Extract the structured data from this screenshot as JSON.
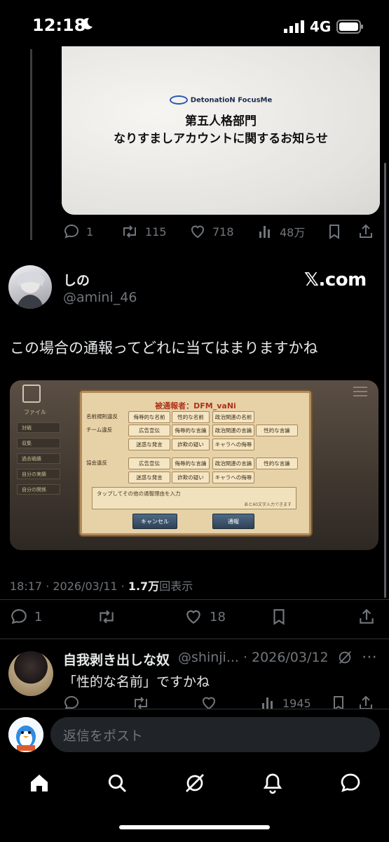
{
  "status": {
    "time": "12:18",
    "network": "4G"
  },
  "quoted_image": {
    "logo": "DetonatioN FocusMe",
    "line1": "第五人格部門",
    "line2": "なりすましアカウントに関するお知らせ"
  },
  "prev_actions": {
    "replies": "1",
    "reposts": "115",
    "likes": "718",
    "views": "48万"
  },
  "tweet": {
    "name": "しの",
    "handle": "@amini_46",
    "watermark": "𝕏.com",
    "text": "この場合の通報ってどれに当てはまりますかね",
    "timestamp": "18:17 · 2026/03/11 · ",
    "views_count": "1.7万",
    "views_suffix": "回表示"
  },
  "game_dialog": {
    "title": "被通報者：DFM_vaNi",
    "row1_label": "名前規則違反",
    "row2_label": "チーム違反",
    "row3_label": "協会違反",
    "chips_row1": [
      "侮辱的な名前",
      "性的な名前",
      "政治関連の名前"
    ],
    "chips_row2a": [
      "広告宣伝",
      "侮辱的な言論",
      "政治関連の言論",
      "性的な言論"
    ],
    "chips_row2b": [
      "迷惑な発言",
      "詐欺の疑い",
      "キャラへの侮辱"
    ],
    "chips_row3a": [
      "広告宣伝",
      "侮辱的な言論",
      "政治関連の言論",
      "性的な言論"
    ],
    "chips_row3b": [
      "迷惑な発言",
      "詐欺の疑い",
      "キャラへの侮辱"
    ],
    "input_placeholder": "タップしてその他の通報理由を入力",
    "char_limit": "あと60文字入力できます",
    "cancel": "キャンセル",
    "submit": "通報",
    "side_menu": [
      "ファイル",
      "対戦",
      "収集",
      "過去戦績",
      "自分の実績",
      "自分の関係"
    ]
  },
  "tweet_actions": {
    "replies": "1",
    "likes": "18"
  },
  "reply": {
    "name": "自我剥き出しな奴",
    "handle": "@shinji... · 2026/03/12",
    "text": "「性的な名前」ですかね",
    "views": "1945"
  },
  "compose": {
    "placeholder": "返信をポスト"
  },
  "colors": {
    "background": "#000000",
    "muted": "#71767b",
    "text": "#e7e9ea",
    "divider": "#2f3336"
  }
}
